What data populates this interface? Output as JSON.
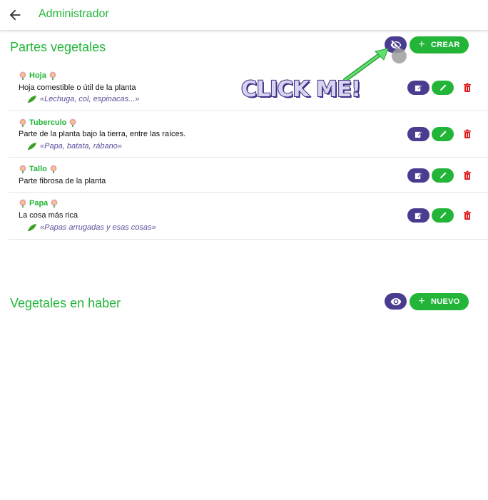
{
  "header": {
    "title": "Administrador"
  },
  "section1": {
    "title": "Partes vegetales",
    "create_label": "CREAR",
    "items": [
      {
        "name": "Hoja",
        "description": "Hoja comestible o útil de la planta",
        "example": "«Lechuga, col, espinacas...»"
      },
      {
        "name": "Tuberculo",
        "description": "Parte de la planta bajo la tierra, entre las raíces.",
        "example": "«Papa, batata, rábano»"
      },
      {
        "name": "Tallo",
        "description": "Parte fibrosa de la planta",
        "example": ""
      },
      {
        "name": "Papa",
        "description": "La cosa más rica",
        "example": "«Papas arrugadas y esas cosas»"
      }
    ]
  },
  "section2": {
    "title": "Vegetales en haber",
    "new_label": "NUEVO"
  },
  "annotation": {
    "text": "CLICK ME!"
  },
  "colors": {
    "green": "#22b538",
    "purple": "#4a3d8f",
    "delete_red": "#e02020",
    "example_text": "#5b4f9c"
  },
  "icons": {
    "back": "arrow-left-icon",
    "visibility_off": "eye-off-icon",
    "visibility": "eye-icon",
    "add": "plus-icon",
    "flower": "flower-emoji-icon",
    "leaf": "leaf-emoji-icon",
    "edit_note": "edit-note-icon",
    "pencil": "pencil-icon",
    "delete": "trash-icon"
  }
}
